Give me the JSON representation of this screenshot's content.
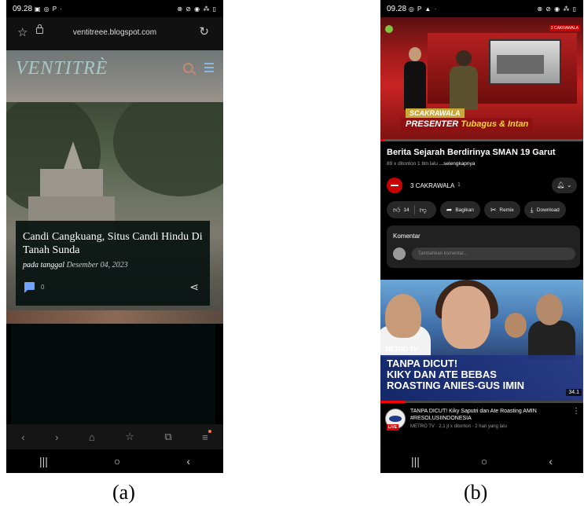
{
  "phone_a": {
    "status": {
      "time": "09.28",
      "icons": "▣ ◎ P ·",
      "right_icons": "⊗ ⊘ ◉ ⁂ ▯"
    },
    "url": {
      "host": "ventitreee.blogspot.com"
    },
    "blog": {
      "brand": "VENTITRÈ"
    },
    "post": {
      "title": "Candi Cangkuang, Situs Candi Hindu Di Tanah Sunda",
      "meta_prefix": "pada tanggal",
      "date": "Desember 04, 2023",
      "comment_count": "0"
    },
    "toolbar": {
      "back": "‹",
      "forward": "›",
      "home": "⌂",
      "bookmark": "☆",
      "tabs": "⧉",
      "menu": "≡"
    },
    "nav": {
      "recent": "|||",
      "home": "○",
      "back": "‹"
    }
  },
  "phone_b": {
    "status": {
      "time": "09.28",
      "icons": "◎ P ▲ ·",
      "right_icons": "⊗ ⊘ ◉ ⁂ ▯"
    },
    "video": {
      "badge": "3 CAKRAWALA",
      "tag1": "SCAKRAWALA",
      "tag2_label": "PRESENTER",
      "tag2_names": "Tubagus & Intan"
    },
    "title": "Berita Sejarah Berdirinya SMAN 19 Garut",
    "subtitle": "89 x ditonton  1 bln lalu",
    "more": "...selengkapnya",
    "channel": {
      "name": "3 CAKRAWALA",
      "subs": "1"
    },
    "actions": {
      "likes": "14",
      "share": "Bagikan",
      "remix": "Remix",
      "download": "Download"
    },
    "comments": {
      "heading": "Komentar",
      "placeholder": "Tambahkan komentar..."
    },
    "next": {
      "logo": "METRO TV",
      "headline": "TANPA DICUT!\nKIKY DAN ATE BEBAS\nROASTING ANIES-GUS IMIN",
      "duration": "34.1",
      "title": "TANPA DICUT! Kiky Saputri dan Ate Roasting AMIN #RESOLUSIINDONESIA",
      "meta": "METRO TV · 2,1 jt x ditonton · 2 hari yang lalu",
      "live": "LIVE"
    },
    "nav": {
      "recent": "|||",
      "home": "○",
      "back": "‹"
    }
  },
  "captions": {
    "a": "(a)",
    "b": "(b)"
  }
}
